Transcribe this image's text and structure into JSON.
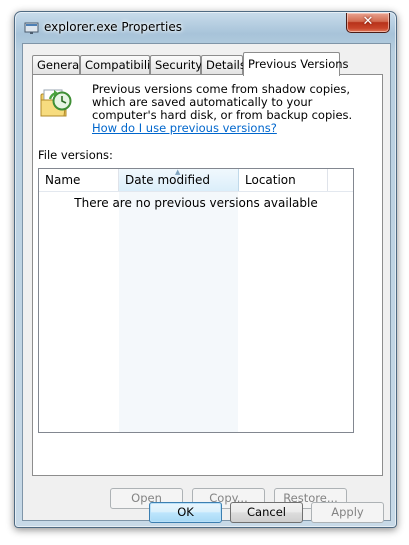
{
  "window": {
    "title": "explorer.exe Properties",
    "close_glyph": "✕"
  },
  "tabs": [
    {
      "label": "General"
    },
    {
      "label": "Compatibility"
    },
    {
      "label": "Security"
    },
    {
      "label": "Details"
    },
    {
      "label": "Previous Versions",
      "active": true
    }
  ],
  "info": {
    "text": "Previous versions come from shadow copies, which are saved automatically to your computer's hard disk, or from backup copies. ",
    "link": "How do I use previous versions?"
  },
  "file_versions": {
    "label": "File versions:",
    "columns": [
      "Name",
      "Date modified",
      "Location"
    ],
    "sorted_column": "Date modified",
    "empty_message": "There are no previous versions available"
  },
  "actions": {
    "open": "Open",
    "copy": "Copy...",
    "restore": "Restore..."
  },
  "dialog": {
    "ok": "OK",
    "cancel": "Cancel",
    "apply": "Apply"
  },
  "colors": {
    "link": "#0066cc",
    "disabled_text": "#838383",
    "default_button_border": "#3c7fb1"
  }
}
